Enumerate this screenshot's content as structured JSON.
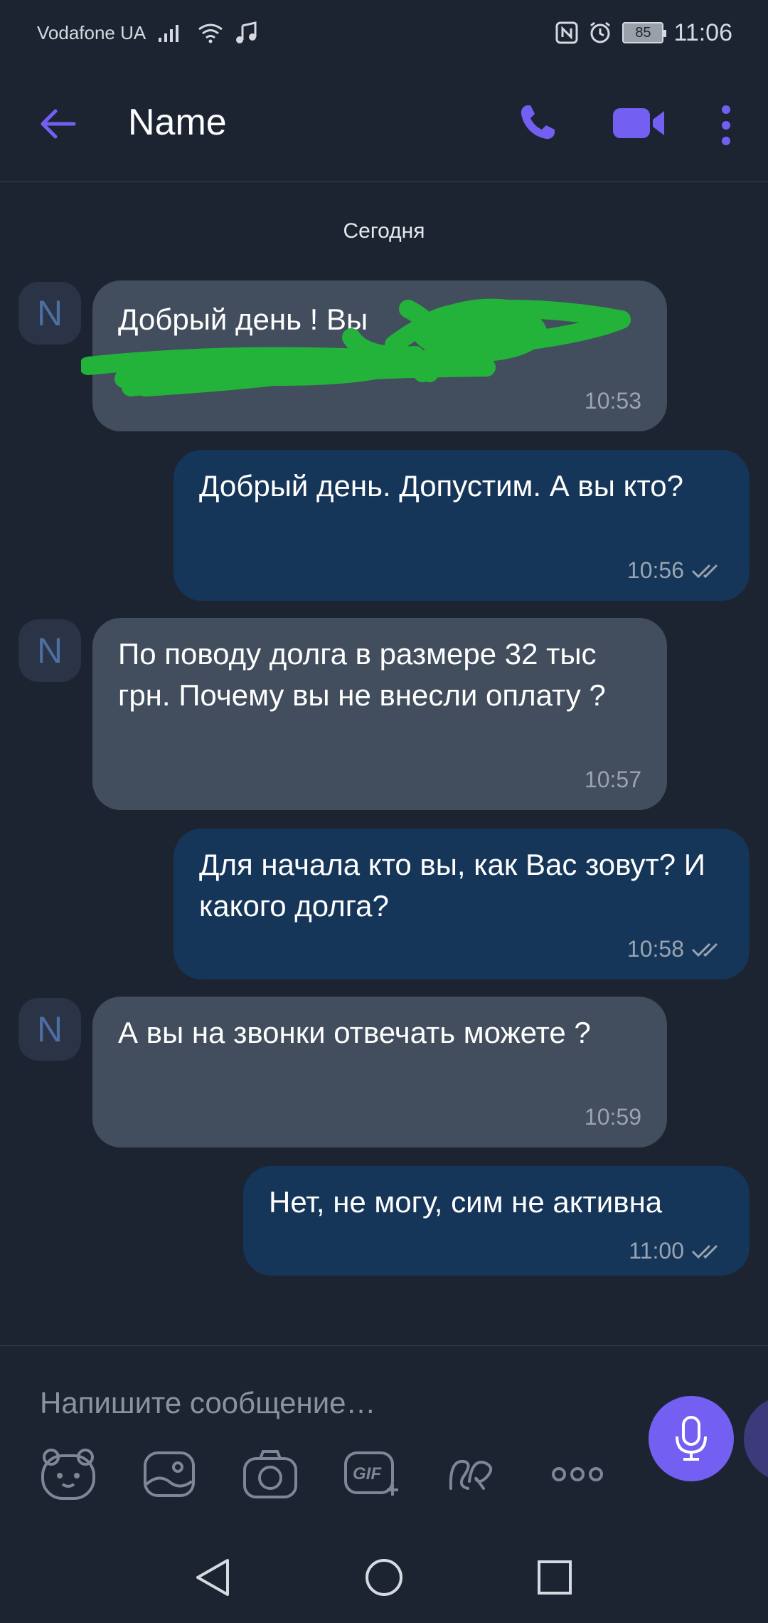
{
  "status_bar": {
    "carrier": "Vodafone UA",
    "battery": "85",
    "time": "11:06"
  },
  "header": {
    "title": "Name",
    "accent": "#7360f2"
  },
  "date_separator": "Сегодня",
  "messages": [
    {
      "direction": "incoming",
      "avatar": "N",
      "text": "Добрый день ! Вы",
      "time": "10:53",
      "redacted": true
    },
    {
      "direction": "outgoing",
      "text": "Добрый день. Допустим. А вы кто?",
      "time": "10:56"
    },
    {
      "direction": "incoming",
      "avatar": "N",
      "text": "По поводу долга в размере 32 тыс грн. Почему вы не внесли оплату ?",
      "time": "10:57"
    },
    {
      "direction": "outgoing",
      "text": "Для начала кто вы, как Вас зовут? И какого долга?",
      "time": "10:58"
    },
    {
      "direction": "incoming",
      "avatar": "N",
      "text": "А вы на звонки отвечать можете ?",
      "time": "10:59"
    },
    {
      "direction": "outgoing",
      "text": "Нет, не могу, сим не активна",
      "time": "11:00"
    }
  ],
  "composer": {
    "placeholder": "Напишите сообщение…",
    "gif_label": "GIF"
  },
  "tools": [
    "sticker-icon",
    "gallery-icon",
    "camera-icon",
    "gif-icon",
    "doodle-icon",
    "more-options-icon"
  ]
}
